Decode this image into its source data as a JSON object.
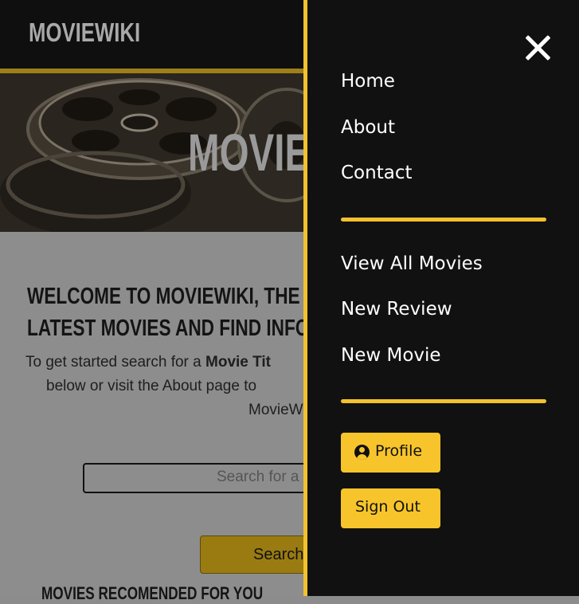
{
  "site": {
    "brand": "MOVIEWIKI",
    "hero_title": "MOVIE"
  },
  "main": {
    "welcome_line1": "WELCOME TO MOVIEWIKI, THE PLAC",
    "welcome_line2": "LATEST MOVIES AND FIND INFORMAT",
    "intro_prefix": "To get started search for a ",
    "intro_bold": "Movie Tit",
    "intro_line2": "below or visit the About page to",
    "intro_line3": "MovieW",
    "search_placeholder": "Search for a",
    "search_button": "Search",
    "recommended_heading": "MOVIES RECOMENDED FOR YOU"
  },
  "menu": {
    "close_icon": "close-icon",
    "primary_links": [
      "Home",
      "About",
      "Contact"
    ],
    "secondary_links": [
      "View All Movies",
      "New Review",
      "New Movie"
    ],
    "profile_button": "Profile",
    "profile_icon": "user-circle-icon",
    "signout_button": "Sign Out"
  },
  "colors": {
    "accent": "#f2c12e",
    "menu_bg": "#111111",
    "header_bg": "#0f0f0f"
  }
}
